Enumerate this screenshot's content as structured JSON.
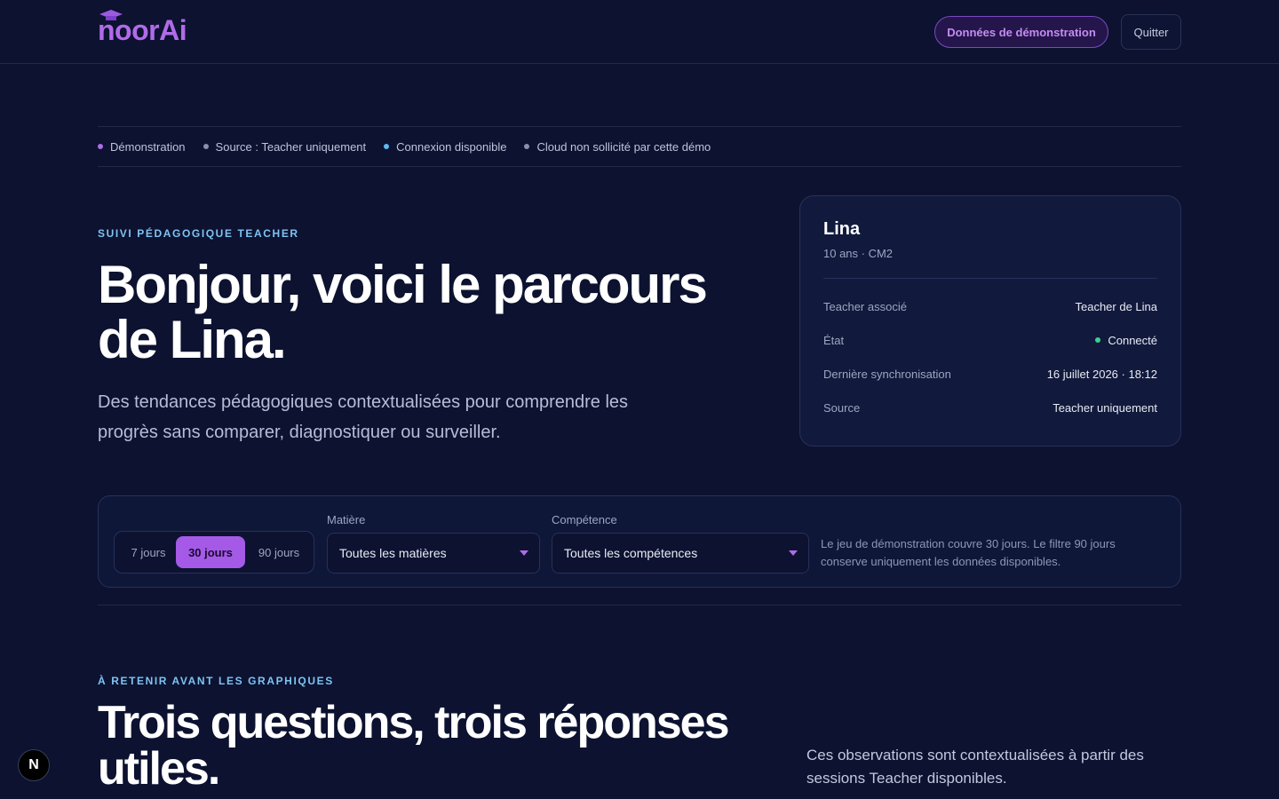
{
  "header": {
    "logo": "noorAi",
    "demo_button": "Données de démonstration",
    "quit_button": "Quitter"
  },
  "status_chips": [
    {
      "label": "Démonstration",
      "color": "#b06be8"
    },
    {
      "label": "Source : Teacher uniquement",
      "color": "#8a90a8"
    },
    {
      "label": "Connexion disponible",
      "color": "#5fb8f0"
    },
    {
      "label": "Cloud non sollicité par cette démo",
      "color": "#8a90a8"
    }
  ],
  "hero": {
    "eyebrow": "SUIVI PÉDAGOGIQUE TEACHER",
    "title": "Bonjour, voici le parcours de Lina.",
    "subtitle": "Des tendances pédagogiques contextualisées pour comprendre les progrès sans comparer, diagnostiquer ou surveiller."
  },
  "profile": {
    "name": "Lina",
    "meta": "10 ans · CM2",
    "rows": [
      {
        "key": "Teacher associé",
        "value": "Teacher de Lina"
      },
      {
        "key": "État",
        "value": "Connecté",
        "status_color": "#3ecf8e"
      },
      {
        "key": "Dernière synchronisation",
        "value": "16 juillet 2026 · 18:12"
      },
      {
        "key": "Source",
        "value": "Teacher uniquement"
      }
    ]
  },
  "filters": {
    "periods": [
      "7 jours",
      "30 jours",
      "90 jours"
    ],
    "active_period": "30 jours",
    "subject_label": "Matière",
    "subject_value": "Toutes les matières",
    "skill_label": "Compétence",
    "skill_value": "Toutes les compétences",
    "note": "Le jeu de démonstration couvre 30 jours. Le filtre 90 jours conserve uniquement les données disponibles."
  },
  "section": {
    "eyebrow": "À RETENIR AVANT LES GRAPHIQUES",
    "title": "Trois questions, trois réponses utiles.",
    "note": "Ces observations sont contextualisées à partir des sessions Teacher disponibles."
  },
  "badge": "N",
  "colors": {
    "accent": "#a45ae6",
    "background": "#0c1230",
    "eyebrow": "#7fc3f2"
  }
}
